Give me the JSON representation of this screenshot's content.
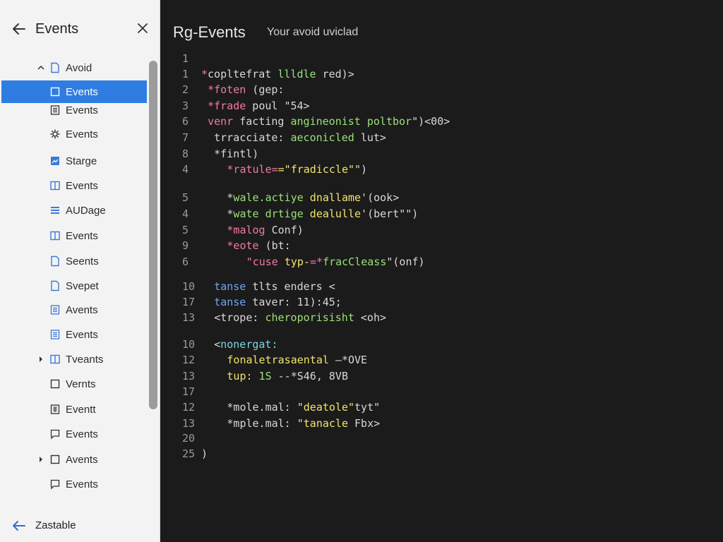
{
  "colors": {
    "sidebar_bg": "#f3f3f3",
    "selection": "#2f7de2",
    "editor_bg": "#1b1b1b",
    "scroll_thumb": "#9c9c9c"
  },
  "sidebar": {
    "title": "Events",
    "items": [
      {
        "label": "Avoid",
        "chevron": "expanded",
        "icon": "file-icon"
      },
      {
        "label": "Events",
        "chevron": "",
        "icon": "square-icon",
        "selected": true
      },
      {
        "label": "Events",
        "chevron": "",
        "icon": "document-lines-icon"
      },
      {
        "label": "Events",
        "chevron": "",
        "icon": "gear-icon"
      },
      {
        "label": "Starge",
        "chevron": "",
        "icon": "image-icon"
      },
      {
        "label": "Events",
        "chevron": "",
        "icon": "columns-icon"
      },
      {
        "label": "AUDage",
        "chevron": "",
        "icon": "stack-icon"
      },
      {
        "label": "Events",
        "chevron": "",
        "icon": "columns-icon"
      },
      {
        "label": "Seents",
        "chevron": "",
        "icon": "file-icon"
      },
      {
        "label": "Svepet",
        "chevron": "",
        "icon": "file-icon"
      },
      {
        "label": "Avents",
        "chevron": "",
        "icon": "list-doc-icon"
      },
      {
        "label": "Events",
        "chevron": "",
        "icon": "list-doc-icon"
      },
      {
        "label": "Tvеants",
        "chevron": "collapsed",
        "icon": "columns-icon"
      },
      {
        "label": "Vernts",
        "chevron": "",
        "icon": "square-icon"
      },
      {
        "label": "Eventt",
        "chevron": "",
        "icon": "grid-doc-icon"
      },
      {
        "label": "Events",
        "chevron": "",
        "icon": "comment-icon"
      },
      {
        "label": "Avents",
        "chevron": "collapsed",
        "icon": "square-icon"
      },
      {
        "label": "Events",
        "chevron": "",
        "icon": "comment-icon"
      }
    ],
    "footer_label": "Zastable"
  },
  "editor": {
    "title": "Rg-Events",
    "subtitle": "Your avoid uviclad",
    "lines": [
      {
        "n": "1",
        "indent": 0,
        "segments": []
      },
      {
        "n": "1",
        "indent": 0,
        "segments": [
          {
            "t": "*",
            "c": "pink"
          },
          {
            "t": "copltefrat ",
            "c": "white"
          },
          {
            "t": "llldle",
            "c": "green"
          },
          {
            "t": " red)>",
            "c": "white"
          }
        ]
      },
      {
        "n": "2",
        "indent": 1,
        "segments": [
          {
            "t": "*foten",
            "c": "pink"
          },
          {
            "t": " (gep:",
            "c": "white"
          }
        ]
      },
      {
        "n": "3",
        "indent": 1,
        "segments": [
          {
            "t": "*frade",
            "c": "pink"
          },
          {
            "t": " poul \"54>",
            "c": "white"
          }
        ]
      },
      {
        "n": "6",
        "indent": 1,
        "segments": [
          {
            "t": "venr",
            "c": "pink"
          },
          {
            "t": " facting ",
            "c": "white"
          },
          {
            "t": "angineonist poltbor",
            "c": "green"
          },
          {
            "t": "\")<00>",
            "c": "white"
          }
        ]
      },
      {
        "n": "7",
        "indent": 1,
        "segments": [
          {
            "t": " trracciate: ",
            "c": "white"
          },
          {
            "t": "aeconicled",
            "c": "green"
          },
          {
            "t": " lut>",
            "c": "white"
          }
        ]
      },
      {
        "n": "8",
        "indent": 1,
        "segments": [
          {
            "t": " *fintl)",
            "c": "white"
          }
        ]
      },
      {
        "n": "4",
        "indent": 4,
        "segments": [
          {
            "t": "*ratule=",
            "c": "pink"
          },
          {
            "t": "=\"fradiccle\"",
            "c": "yellow"
          },
          {
            "t": "\")",
            "c": "white"
          }
        ]
      },
      {
        "n": "",
        "indent": 0,
        "segments": []
      },
      {
        "n": "5",
        "indent": 4,
        "segments": [
          {
            "t": "*",
            "c": "white"
          },
          {
            "t": "wale.actiye ",
            "c": "green"
          },
          {
            "t": "dnallame",
            "c": "yellow"
          },
          {
            "t": "'(ook>",
            "c": "white"
          }
        ]
      },
      {
        "n": "4",
        "indent": 4,
        "segments": [
          {
            "t": "*",
            "c": "white"
          },
          {
            "t": "wate drtige ",
            "c": "green"
          },
          {
            "t": "dealulle",
            "c": "yellow"
          },
          {
            "t": "'(bert\"\")",
            "c": "white"
          }
        ]
      },
      {
        "n": "5",
        "indent": 4,
        "segments": [
          {
            "t": "*malog",
            "c": "pink"
          },
          {
            "t": " Conf)",
            "c": "white"
          }
        ]
      },
      {
        "n": "9",
        "indent": 4,
        "segments": [
          {
            "t": "*eote",
            "c": "pink"
          },
          {
            "t": " (bt:",
            "c": "white"
          }
        ]
      },
      {
        "n": "6",
        "indent": 7,
        "segments": [
          {
            "t": "\"cuse ",
            "c": "pink"
          },
          {
            "t": "typ-",
            "c": "yellow"
          },
          {
            "t": "=*",
            "c": "pink"
          },
          {
            "t": "fracCleass",
            "c": "green"
          },
          {
            "t": "\"(onf)",
            "c": "white"
          }
        ]
      },
      {
        "n": "",
        "indent": 0,
        "segments": []
      },
      {
        "n": "10",
        "indent": 2,
        "segments": [
          {
            "t": "tanse",
            "c": "blue"
          },
          {
            "t": " tlts enders <",
            "c": "white"
          }
        ]
      },
      {
        "n": "17",
        "indent": 2,
        "segments": [
          {
            "t": "tanse",
            "c": "blue"
          },
          {
            "t": " taver: 11):45;",
            "c": "white"
          }
        ]
      },
      {
        "n": "13",
        "indent": 2,
        "segments": [
          {
            "t": "<trope: ",
            "c": "white"
          },
          {
            "t": "cheroporisisht",
            "c": "green"
          },
          {
            "t": " <oh>",
            "c": "white"
          }
        ]
      },
      {
        "n": "",
        "indent": 0,
        "segments": []
      },
      {
        "n": "10",
        "indent": 2,
        "segments": [
          {
            "t": "<",
            "c": "white"
          },
          {
            "t": "nonergat:",
            "c": "cyan"
          }
        ]
      },
      {
        "n": "12",
        "indent": 4,
        "segments": [
          {
            "t": "fonaletrasaental",
            "c": "yellow"
          },
          {
            "t": " —*OVE",
            "c": "white"
          }
        ]
      },
      {
        "n": "13",
        "indent": 4,
        "segments": [
          {
            "t": "tup:",
            "c": "yellow"
          },
          {
            "t": " 1S",
            "c": "green"
          },
          {
            "t": " --*S46, 8VB",
            "c": "white"
          }
        ]
      },
      {
        "n": "17",
        "indent": 0,
        "segments": []
      },
      {
        "n": "12",
        "indent": 4,
        "segments": [
          {
            "t": "*mole.mal: ",
            "c": "white"
          },
          {
            "t": "\"deatole\"",
            "c": "yellow"
          },
          {
            "t": "tyt\"",
            "c": "white"
          }
        ]
      },
      {
        "n": "13",
        "indent": 4,
        "segments": [
          {
            "t": "*mple.mal: ",
            "c": "white"
          },
          {
            "t": "\"tanacle",
            "c": "yellow"
          },
          {
            "t": " Fbx>",
            "c": "white"
          }
        ]
      },
      {
        "n": "20",
        "indent": 0,
        "segments": []
      },
      {
        "n": "25",
        "indent": 0,
        "segments": [
          {
            "t": ")",
            "c": "white"
          }
        ]
      }
    ]
  }
}
